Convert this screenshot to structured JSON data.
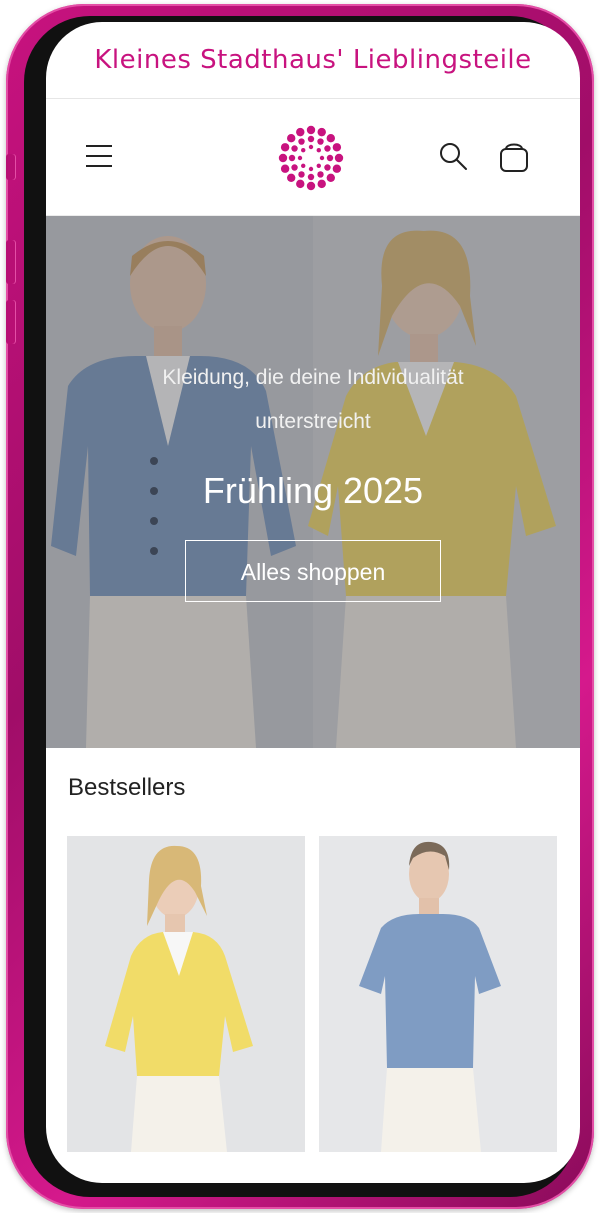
{
  "announcement": {
    "text": "Kleines Stadthaus' Lieblingsteile"
  },
  "header": {
    "menu_icon": "hamburger-menu-icon",
    "logo_icon": "dotted-sun-logo",
    "search_icon": "search-icon",
    "cart_icon": "cart-icon"
  },
  "hero": {
    "subtitle": "Kleidung, die deine Individualität unterstreicht",
    "title": "Frühling 2025",
    "button_label": "Alles shoppen"
  },
  "bestsellers": {
    "heading": "Bestsellers"
  },
  "colors": {
    "brand": "#c8137f",
    "frame": "#b80f74",
    "cardigan_blue": "#7d98bd",
    "cardigan_yellow": "#f0dc6a",
    "pants_white": "#eeeae2"
  }
}
